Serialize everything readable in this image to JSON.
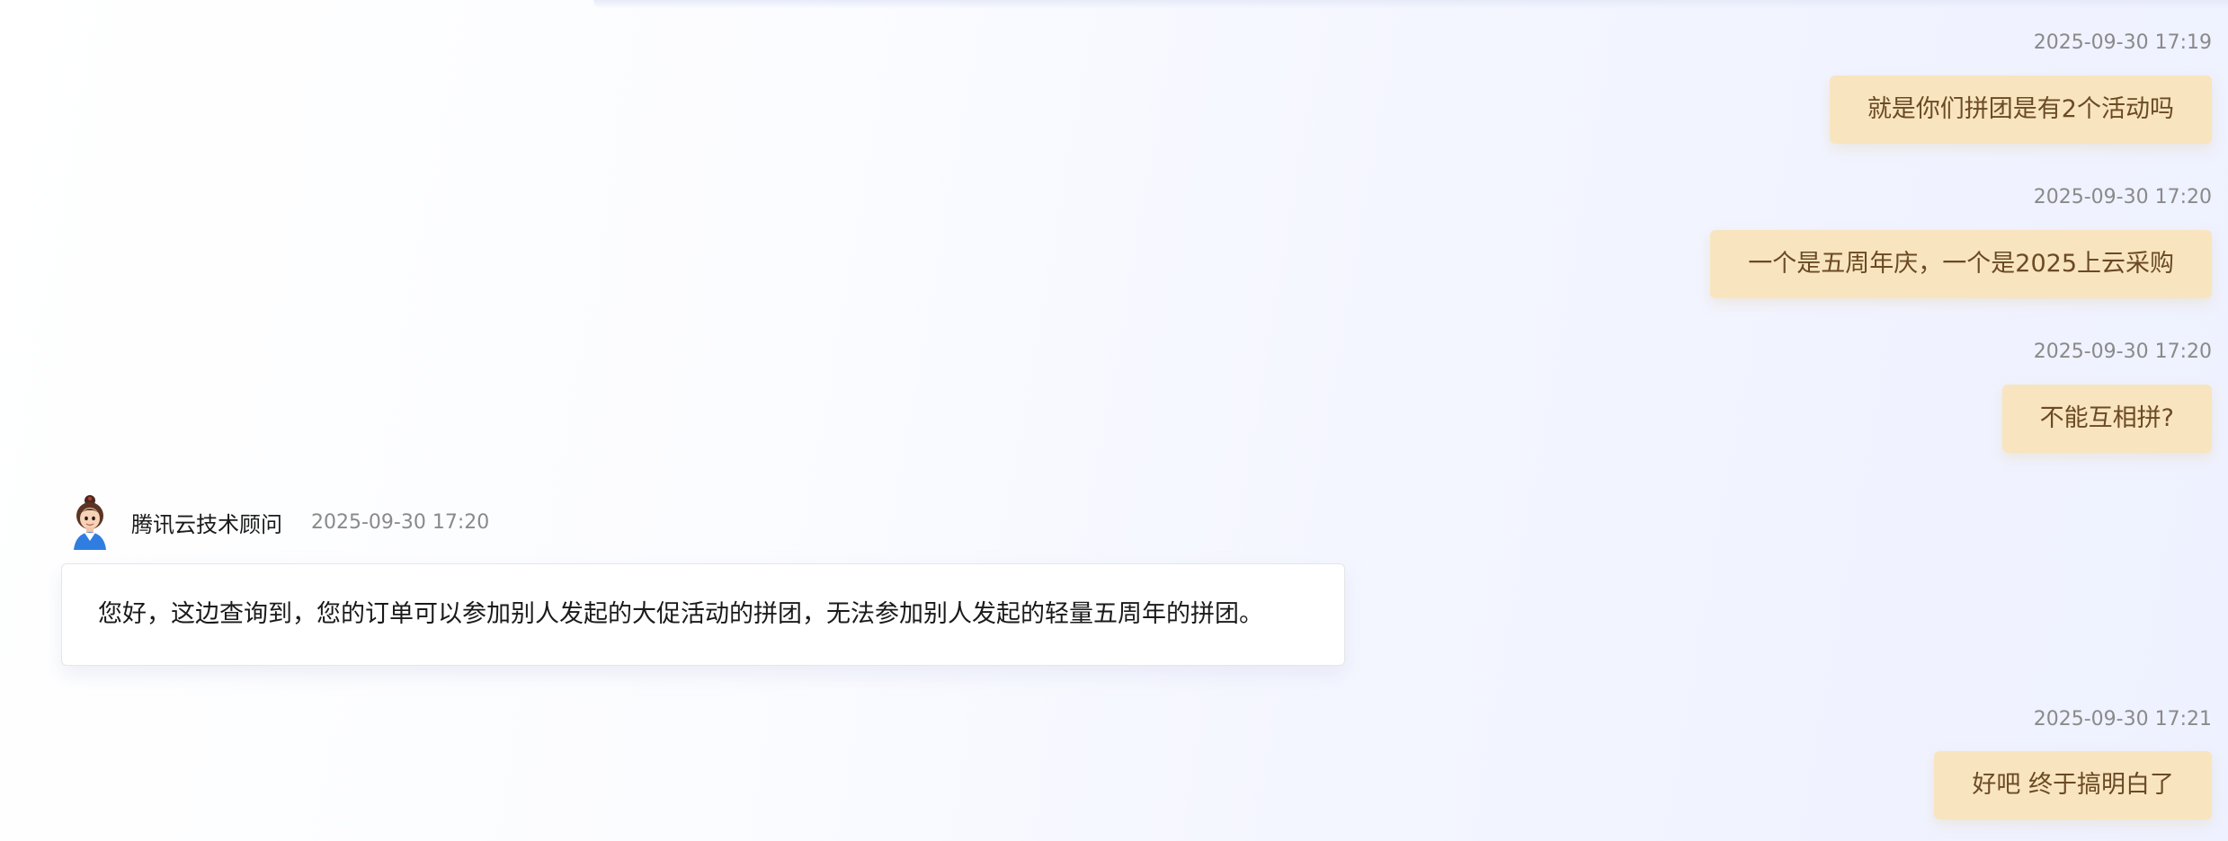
{
  "messages": [
    {
      "role": "user",
      "timestamp": "2025-09-30 17:19",
      "text": "就是你们拼团是有2个活动吗"
    },
    {
      "role": "user",
      "timestamp": "2025-09-30 17:20",
      "text": "一个是五周年庆，一个是2025上云采购"
    },
    {
      "role": "user",
      "timestamp": "2025-09-30 17:20",
      "text": "不能互相拼?"
    },
    {
      "role": "agent",
      "sender": "腾讯云技术顾问",
      "avatar_icon": "advisor-avatar-icon",
      "timestamp": "2025-09-30 17:20",
      "text": "您好，这边查询到，您的订单可以参加别人发起的大促活动的拼团，无法参加别人发起的轻量五周年的拼团。"
    },
    {
      "role": "user",
      "timestamp": "2025-09-30 17:21",
      "text": "好吧 终于搞明白了"
    }
  ],
  "colors": {
    "user_bubble_bg": "#f8e5bf",
    "user_bubble_text": "#6b4a24",
    "agent_bubble_bg": "#ffffff",
    "timestamp_text": "#8a8a8a"
  }
}
